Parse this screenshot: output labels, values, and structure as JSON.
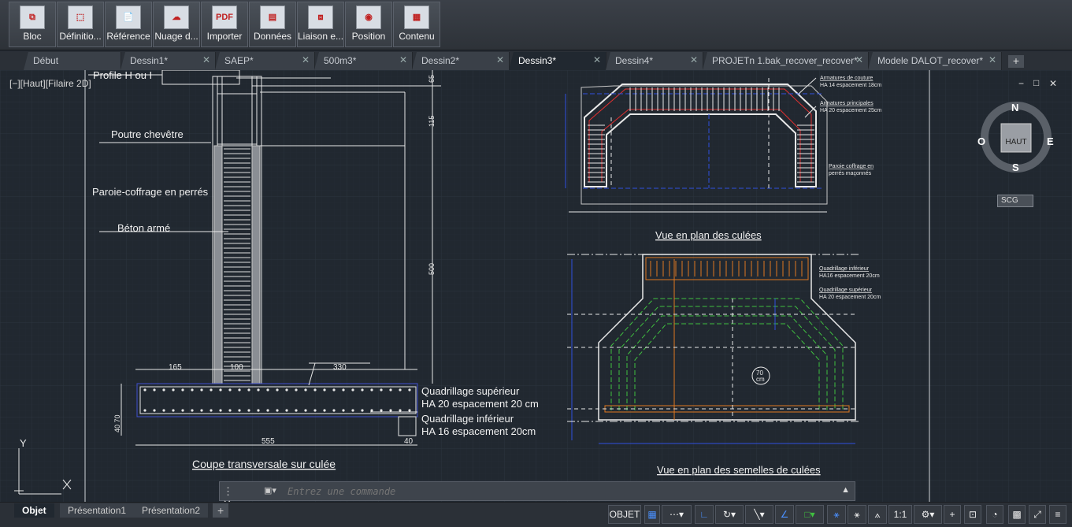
{
  "ribbon": {
    "buttons": [
      {
        "label": "Bloc",
        "icon": "block-icon"
      },
      {
        "label": "Définitio...",
        "icon": "attribute-definition-icon"
      },
      {
        "label": "Référence",
        "icon": "external-reference-icon"
      },
      {
        "label": "Nuage d...",
        "icon": "point-cloud-icon"
      },
      {
        "label": "Importer",
        "icon": "pdf-import-icon"
      },
      {
        "label": "Données",
        "icon": "data-extraction-icon"
      },
      {
        "label": "Liaison e...",
        "icon": "data-link-icon"
      },
      {
        "label": "Position",
        "icon": "geolocation-icon"
      },
      {
        "label": "Contenu",
        "icon": "content-browser-icon"
      }
    ]
  },
  "tabs": [
    {
      "label": "Début",
      "closable": false,
      "active": false
    },
    {
      "label": "Dessin1*",
      "closable": true,
      "active": false
    },
    {
      "label": "SAEP*",
      "closable": true,
      "active": false
    },
    {
      "label": "500m3*",
      "closable": true,
      "active": false
    },
    {
      "label": "Dessin2*",
      "closable": true,
      "active": false
    },
    {
      "label": "Dessin3*",
      "closable": true,
      "active": true
    },
    {
      "label": "Dessin4*",
      "closable": true,
      "active": false
    },
    {
      "label": "PROJETn 1.bak_recover_recover*",
      "closable": true,
      "active": false
    },
    {
      "label": "Modele DALOT_recover*",
      "closable": true,
      "active": false
    }
  ],
  "add_tab": "+",
  "viewport": {
    "label": "[−][Haut][Filaire 2D]",
    "compass": {
      "n": "N",
      "s": "S",
      "e": "E",
      "w": "O",
      "center": "HAUT",
      "ucs": "SCG"
    },
    "ucs_y": "Y",
    "window_buttons": [
      "−",
      "□",
      "✕"
    ]
  },
  "drawing": {
    "section": {
      "labels": {
        "profile": "Profile H ou I",
        "cap_beam": "Poutre chevêtre",
        "wall": "Paroie-coffrage en perrés",
        "concrete": "Béton armé",
        "top_mesh": "Quadrillage supérieur",
        "top_mesh_spec": "HA 20 espacement 20 cm",
        "bottom_mesh": "Quadrillage inférieur",
        "bottom_mesh_spec": "HA 16 espacement 20cm",
        "title": "Coupe transversale sur culée"
      },
      "dims": {
        "d165": "165",
        "d100": "100",
        "d330": "330",
        "d555": "555",
        "d40": "40",
        "v65": "65",
        "v115": "115",
        "v500": "500",
        "v4070": "40 70"
      }
    },
    "plan_abutments": {
      "title": "Vue en plan des culées",
      "notes": {
        "n1": "Armatures de couture",
        "n1b": "HA 14 espacement 18cm",
        "n2": "Armatures principales",
        "n2b": "HA 20 espacement 25cm",
        "n3": "Paroie coffrage en",
        "n3b": "perrés maçonnés"
      }
    },
    "plan_footings": {
      "title": "Vue en plan des semelles de culées",
      "notes": {
        "n1": "Quadrillage inférieur",
        "n1b": "HA16 espacement 20cm",
        "n2": "Quadrillage supérieur",
        "n2b": "HA 20 espacement 20cm",
        "marker": "70",
        "marker_b": "cm"
      }
    }
  },
  "command": {
    "placeholder": "Entrez une commande"
  },
  "layout_tabs": [
    {
      "label": "Objet",
      "active": true
    },
    {
      "label": "Présentation1",
      "active": false
    },
    {
      "label": "Présentation2",
      "active": false
    }
  ],
  "status": {
    "model_label": "OBJET",
    "scale": "1:1"
  },
  "colors": {
    "background": "#212830",
    "red": "#e03030",
    "orange": "#e07820",
    "green": "#40c040",
    "blue": "#3050e0",
    "white": "#e8e8e8"
  }
}
